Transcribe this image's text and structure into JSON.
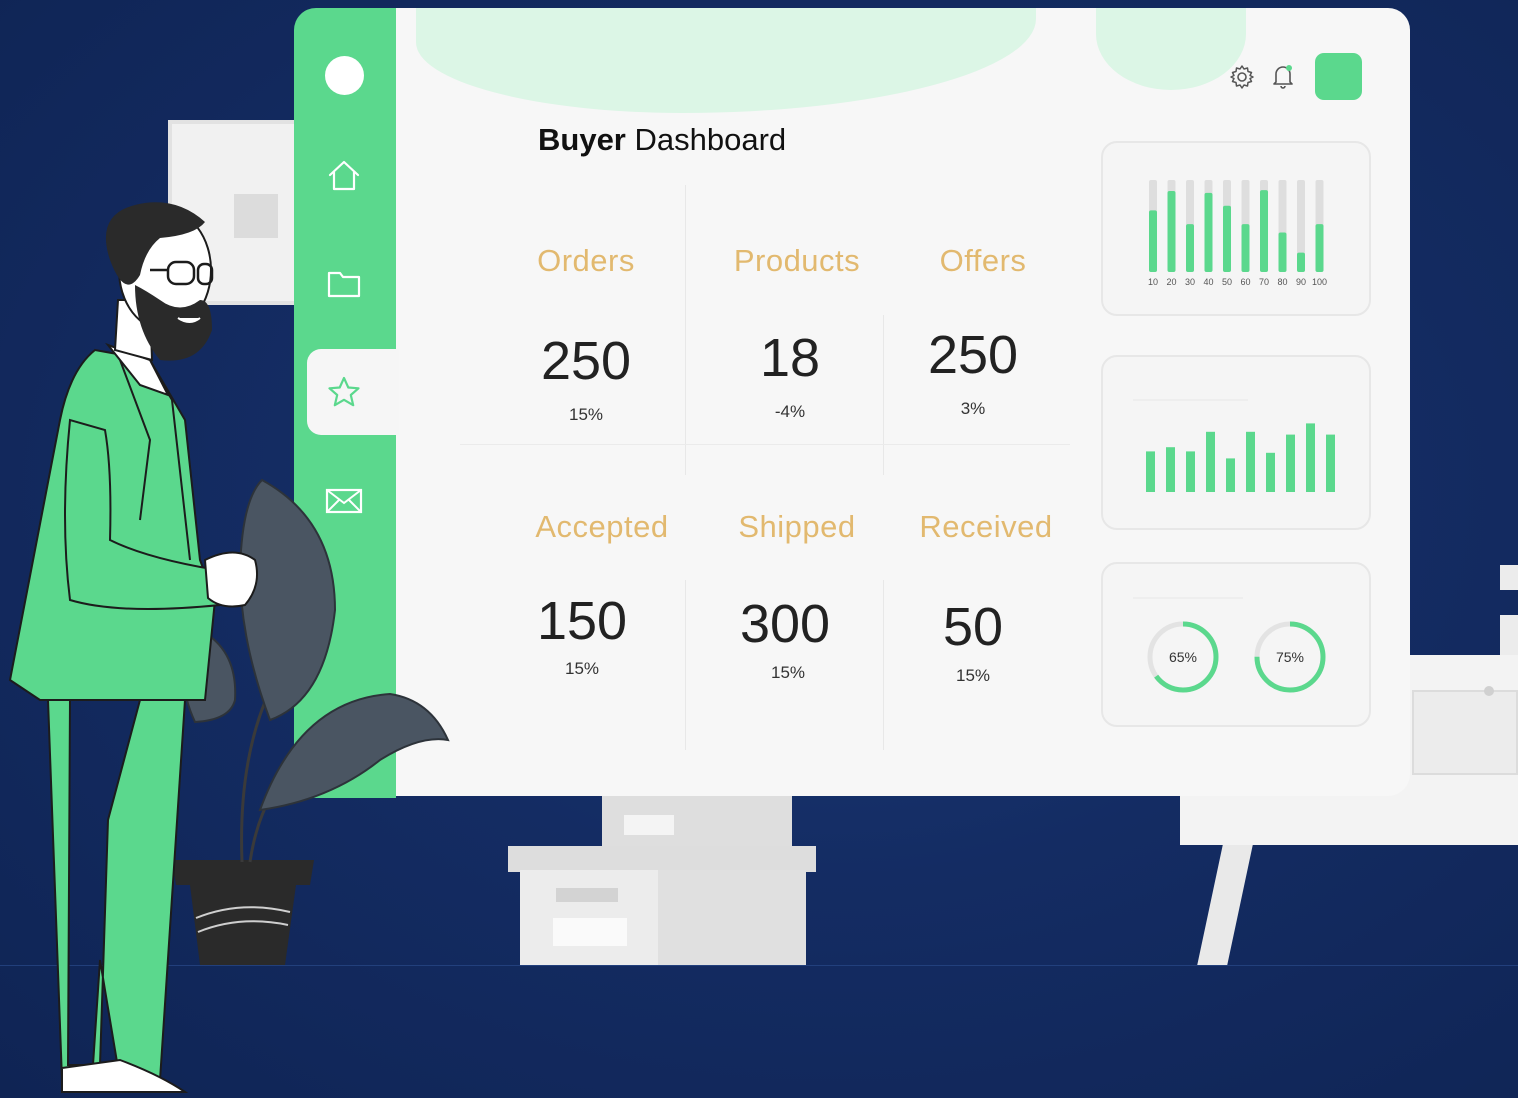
{
  "header": {
    "title_bold": "Buyer",
    "title_rest": " Dashboard"
  },
  "topbar": {
    "icons": [
      "gear-icon",
      "bell-icon",
      "avatar"
    ]
  },
  "sidebar": {
    "items": [
      {
        "name": "profile-dot"
      },
      {
        "name": "home-icon"
      },
      {
        "name": "folder-icon"
      },
      {
        "name": "star-icon",
        "active": true
      },
      {
        "name": "mail-icon"
      }
    ]
  },
  "stats": [
    {
      "label": "Orders",
      "value": "250",
      "change": "15%"
    },
    {
      "label": "Products",
      "value": "18",
      "change": "-4%"
    },
    {
      "label": "Offers",
      "value": "250",
      "change": "3%"
    },
    {
      "label": "Accepted",
      "value": "150",
      "change": "15%"
    },
    {
      "label": "Shipped",
      "value": "300",
      "change": "15%"
    },
    {
      "label": "Received",
      "value": "50",
      "change": "15%"
    }
  ],
  "colors": {
    "accent": "#5bd88d",
    "label": "#e2b96f",
    "background": "#142c63"
  },
  "chart_data": [
    {
      "type": "bar",
      "categories": [
        "10",
        "20",
        "30",
        "40",
        "50",
        "60",
        "70",
        "80",
        "90",
        "100"
      ],
      "series": [
        {
          "values": [
            0.67,
            0.88,
            0.52,
            0.86,
            0.72,
            0.52,
            0.89,
            0.43,
            0.21,
            0.52
          ]
        }
      ],
      "track": true
    },
    {
      "type": "bar",
      "categories": [
        "",
        "",
        "",
        "",
        "",
        "",
        "",
        "",
        "",
        ""
      ],
      "series": [
        {
          "values": [
            0.58,
            0.64,
            0.58,
            0.86,
            0.48,
            0.86,
            0.56,
            0.82,
            0.98,
            0.82
          ]
        }
      ]
    },
    {
      "type": "pie",
      "gauges": [
        {
          "label": "65%",
          "value": 65
        },
        {
          "label": "75%",
          "value": 75
        }
      ]
    }
  ]
}
